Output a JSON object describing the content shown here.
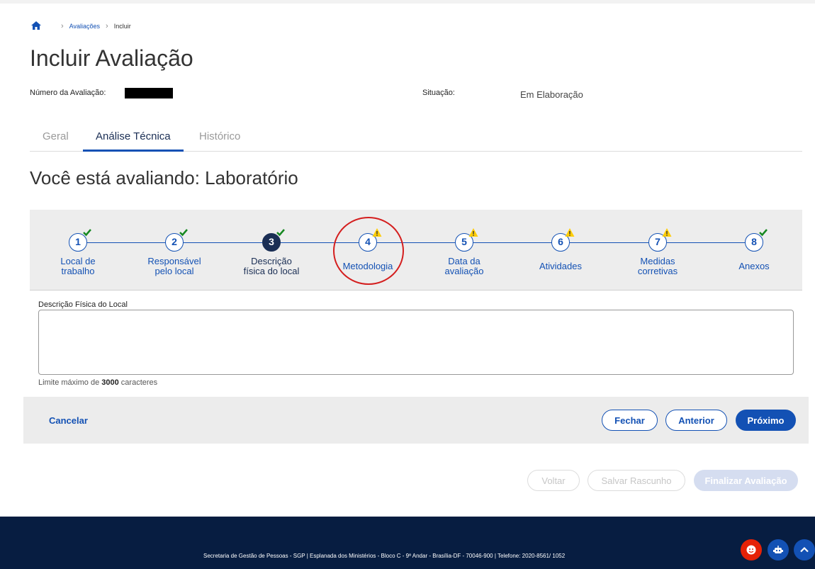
{
  "breadcrumb": {
    "items": [
      "Avaliações",
      "Incluir"
    ]
  },
  "page": {
    "title": "Incluir Avaliação",
    "number_label": "Número da Avaliação:",
    "status_label": "Situação:",
    "status_value": "Em Elaboração"
  },
  "tabs": [
    {
      "label": "Geral",
      "active": false
    },
    {
      "label": "Análise Técnica",
      "active": true
    },
    {
      "label": "Histórico",
      "active": false
    }
  ],
  "evaluating": "Você está avaliando: Laboratório",
  "steps": [
    {
      "number": "1",
      "label_line1": "Local de",
      "label_line2": "trabalho",
      "status": "complete"
    },
    {
      "number": "2",
      "label_line1": "Responsável",
      "label_line2": "pelo local",
      "status": "complete"
    },
    {
      "number": "3",
      "label_line1": "Descrição",
      "label_line2": "física do local",
      "status": "complete",
      "current": true
    },
    {
      "number": "4",
      "label": "Metodologia",
      "status": "warning"
    },
    {
      "number": "5",
      "label_line1": "Data da",
      "label_line2": "avaliação",
      "status": "warning"
    },
    {
      "number": "6",
      "label": "Atividades",
      "status": "warning"
    },
    {
      "number": "7",
      "label_line1": "Medidas",
      "label_line2": "corretivas",
      "status": "warning"
    },
    {
      "number": "8",
      "label": "Anexos",
      "status": "complete"
    }
  ],
  "form": {
    "field_label": "Descrição Física do Local",
    "field_value": "",
    "hint_prefix": "Limite máximo de ",
    "hint_limit": "3000",
    "hint_suffix": " caracteres"
  },
  "actions": {
    "cancel": "Cancelar",
    "close": "Fechar",
    "previous": "Anterior",
    "next": "Próximo"
  },
  "bottom_actions": {
    "back": "Voltar",
    "save_draft": "Salvar Rascunho",
    "finish": "Finalizar Avaliação"
  },
  "footer": {
    "text": "Secretaria de Gestão de Pessoas - SGP | Esplanada dos Ministérios - Bloco C - 9º Andar - Brasília-DF - 70046-900 | Telefone: 2020-8561/ 1052"
  },
  "icons": {
    "home": "home-icon",
    "check": "check-icon",
    "warning": "warning-icon",
    "chat": "chat-icon",
    "robot": "robot-icon",
    "up": "chevron-up-icon"
  },
  "colors": {
    "primary": "#1351b4",
    "dark": "#1a2e54",
    "footer": "#071d41",
    "check": "#168821",
    "warning": "#ffcd07",
    "highlight": "#d41e1e"
  }
}
